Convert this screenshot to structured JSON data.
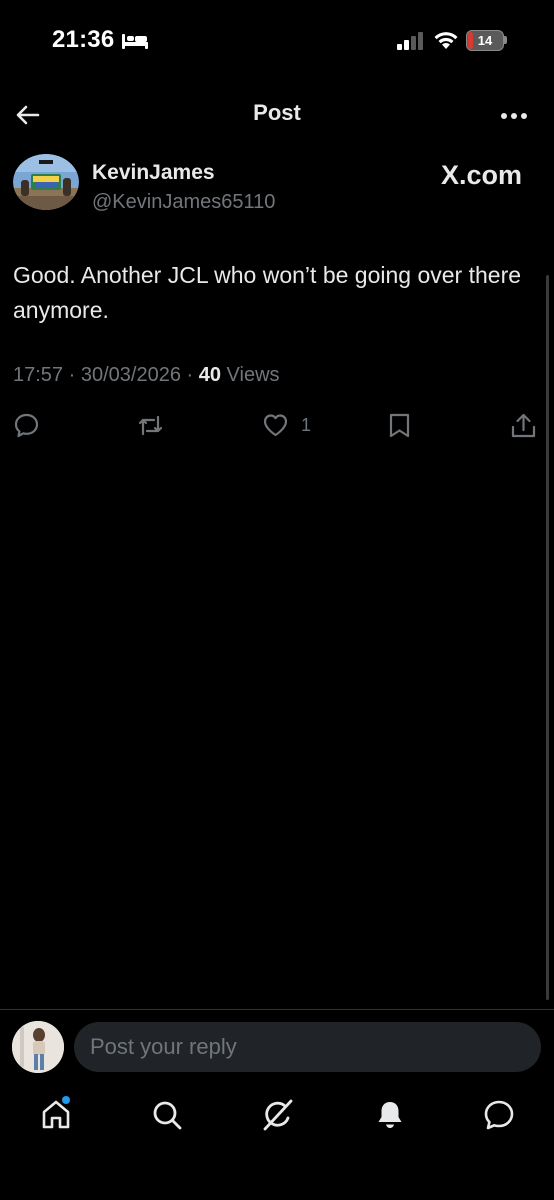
{
  "status_bar": {
    "time": "21:36",
    "battery_level": "14",
    "battery_color": "#d63a33"
  },
  "header": {
    "title": "Post",
    "back_icon": "arrow-left-icon",
    "more_icon": "more-horizontal-icon"
  },
  "post": {
    "author_name": "KevinJames",
    "author_handle": "@KevinJames65110",
    "watermark": "X.com",
    "text": "Good. Another JCL who won’t be going over there anymore.",
    "time": "17:57",
    "date": "30/03/2026",
    "views_count": "40",
    "views_label": "Views",
    "actions": {
      "reply": {
        "icon": "reply-icon",
        "count": ""
      },
      "repost": {
        "icon": "repost-icon",
        "count": ""
      },
      "like": {
        "icon": "heart-icon",
        "count": "1"
      },
      "bookmark": {
        "icon": "bookmark-icon",
        "count": ""
      },
      "share": {
        "icon": "share-icon",
        "count": ""
      }
    }
  },
  "reply_bar": {
    "placeholder": "Post your reply"
  },
  "bottom_nav": [
    {
      "icon": "home-icon",
      "has_notification_dot": true
    },
    {
      "icon": "search-icon"
    },
    {
      "icon": "grok-icon"
    },
    {
      "icon": "bell-icon"
    },
    {
      "icon": "chat-icon"
    }
  ],
  "colors": {
    "background": "#000000",
    "text_primary": "#e7e9ea",
    "text_secondary": "#71767b",
    "accent": "#1d9bf0"
  }
}
